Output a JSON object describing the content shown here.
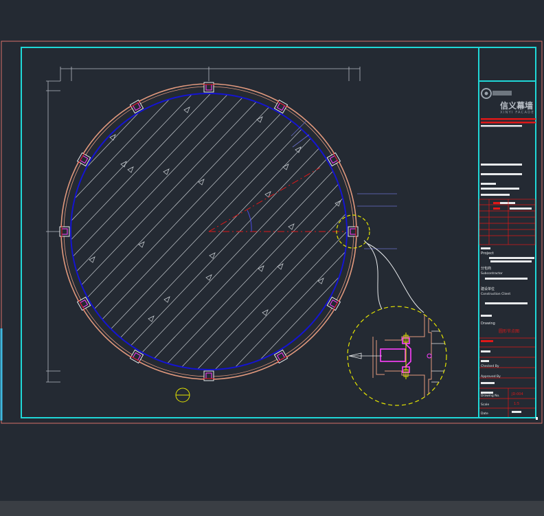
{
  "drawing": {
    "colors": {
      "background": "#242a33",
      "sheet_border": "#d8706a",
      "frame": "#1fd8d8",
      "outer_ring": "#e39a7e",
      "inner_circle": "#1414d2",
      "hatch": "#c8cdd2",
      "center_line": "#e01818",
      "clip": "#ff40ff",
      "detail_circle": "#e6e600",
      "leader": "#e8eaec",
      "dimension": "#9aa0c8"
    }
  },
  "title_block": {
    "company_cn": "信义幕墙",
    "company_en": "XINYI FACADE",
    "project_label": "Project",
    "contractor_label": "Subcontractor",
    "contractor_label_cn": "分包商",
    "construction_label": "Construction Client",
    "construction_label_cn": "建设单位",
    "drawing_label": "Drawing",
    "drawing_title": "圆形节点图",
    "checked_label": "Checked By",
    "approved_label": "Approved By",
    "drawing_no_label": "Drawing No.",
    "drawing_no": "JD-004",
    "scale_label": "Scale",
    "scale": "1:5",
    "date_label": "Date"
  },
  "icons": [
    "company-logo-icon",
    "section-marker-icon",
    "zoom-bubble-icon"
  ]
}
